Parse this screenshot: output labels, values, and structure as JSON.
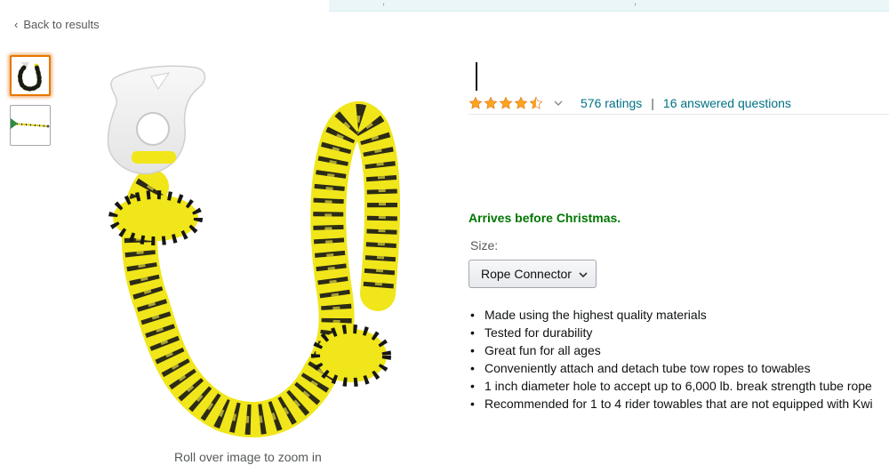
{
  "nav": {
    "back_label": "Back to results"
  },
  "gallery": {
    "zoom_hint": "Roll over image to zoom in",
    "thumbnails": [
      "rope-connector-thumb",
      "tow-rope-thumb"
    ]
  },
  "product": {
    "rating": {
      "stars": 4.5,
      "ratings_text": "576 ratings",
      "separator": "|",
      "questions_text": "16 answered questions"
    },
    "delivery_note": "Arrives before Christmas.",
    "size": {
      "label": "Size:",
      "selected": "Rope Connector"
    },
    "bullets": [
      "Made using the highest quality materials",
      "Tested for durability",
      "Great fun for all ages",
      "Conveniently attach and detach tube tow ropes to towables",
      "1 inch diameter hole to accept up to 6,000 lb. break strength tube rope",
      "Recommended for 1 to 4 rider towables that are not equipped with Kwi"
    ]
  },
  "colors": {
    "link": "#007185",
    "delivery_green": "#007600",
    "star": "#ffa41c",
    "rope_yellow": "#f2ea1b",
    "rope_black": "#1a1a1a"
  }
}
